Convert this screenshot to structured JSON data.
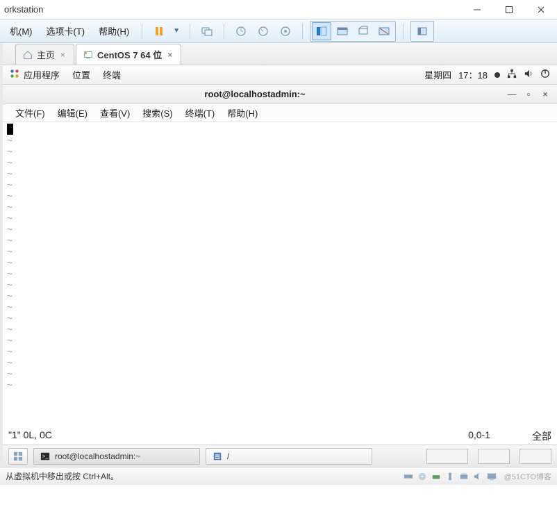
{
  "vmware": {
    "title": "orkstation",
    "menu": {
      "machine": "机(M)",
      "tabs": "选项卡(T)",
      "help": "帮助(H)"
    },
    "status_hint": "从虚拟机中移出或按 Ctrl+Alt。",
    "watermark": "@51CTO博客"
  },
  "tabs": {
    "home": "主页",
    "vm": "CentOS 7 64 位"
  },
  "gnome": {
    "apps": "应用程序",
    "places": "位置",
    "terminal": "终端",
    "day": "星期四",
    "time": "17：18"
  },
  "terminal": {
    "title": "root@localhostadmin:~",
    "menu": {
      "file": "文件(F)",
      "edit": "编辑(E)",
      "view": "查看(V)",
      "search": "搜索(S)",
      "terminal": "终端(T)",
      "help": "帮助(H)"
    },
    "vim_status_left": "\"1\" 0L, 0C",
    "vim_status_mid": "0,0-1",
    "vim_status_right": "全部"
  },
  "taskbar": {
    "term_task": "root@localhostadmin:~",
    "path_task": "/"
  }
}
